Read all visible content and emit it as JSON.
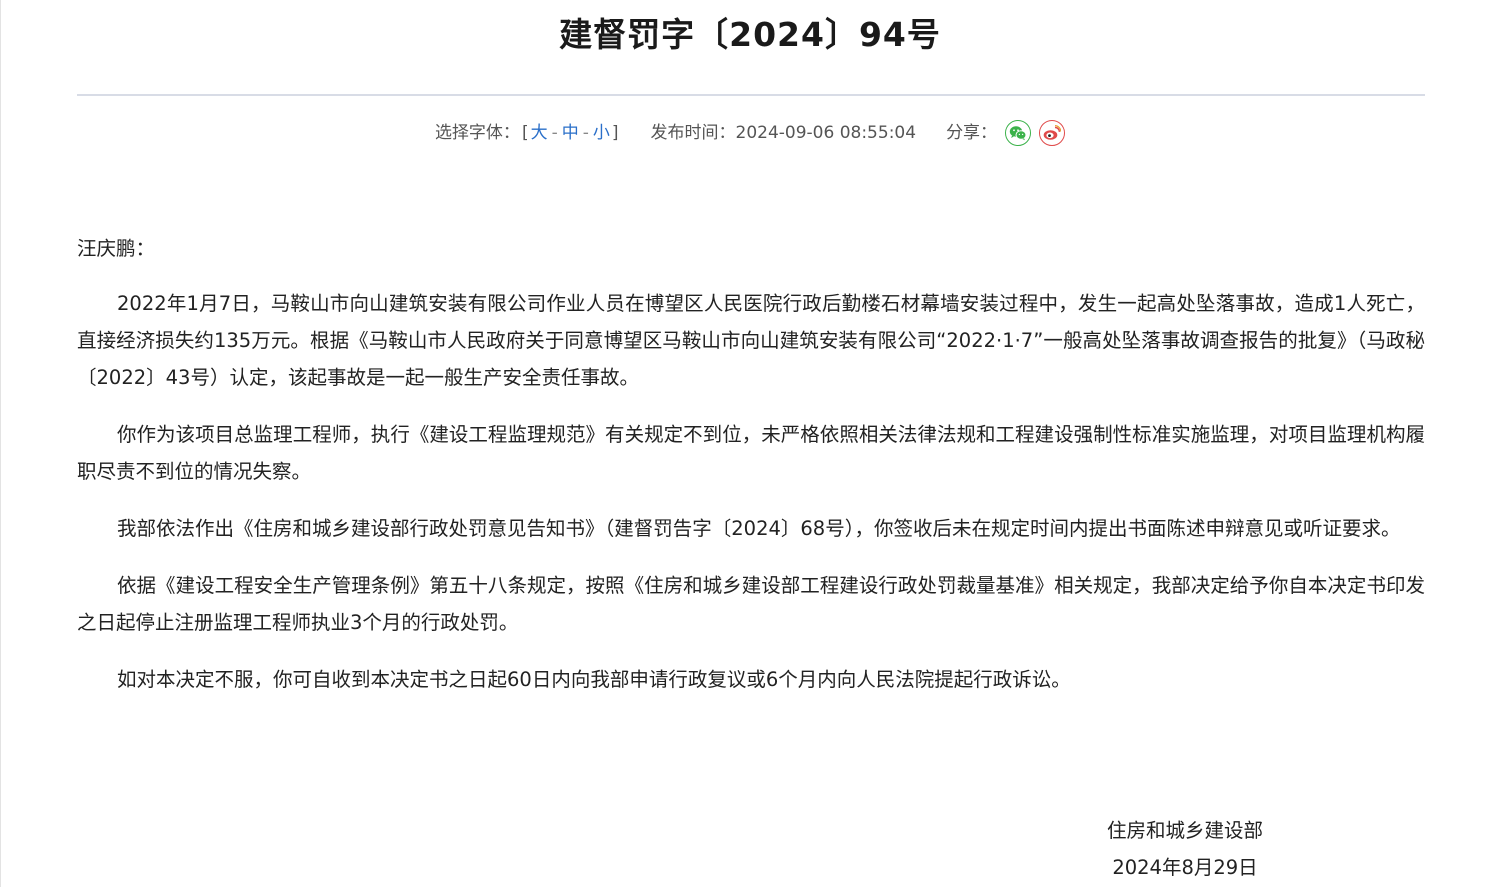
{
  "document": {
    "title": "建督罚字〔2024〕94号"
  },
  "meta": {
    "font_label": "选择字体：",
    "bracket_open": "[",
    "bracket_close": "]",
    "size_large": "大",
    "size_medium": "中",
    "size_small": "小",
    "separator": "-",
    "publish_label": "发布时间：",
    "publish_time": "2024-09-06 08:55:04",
    "share_label": "分享：",
    "share_icons": [
      "wechat-icon",
      "weibo-icon"
    ],
    "colors": {
      "link": "#2a6fc9",
      "wechat": "#3bb24a",
      "weibo": "#e04a4a",
      "divider": "#d8dce6"
    }
  },
  "body": {
    "salutation": "汪庆鹏：",
    "paragraphs": [
      "2022年1月7日，马鞍山市向山建筑安装有限公司作业人员在博望区人民医院行政后勤楼石材幕墙安装过程中，发生一起高处坠落事故，造成1人死亡，直接经济损失约135万元。根据《马鞍山市人民政府关于同意博望区马鞍山市向山建筑安装有限公司“2022·1·7”一般高处坠落事故调查报告的批复》（马政秘〔2022〕43号）认定，该起事故是一起一般生产安全责任事故。",
      "你作为该项目总监理工程师，执行《建设工程监理规范》有关规定不到位，未严格依照相关法律法规和工程建设强制性标准实施监理，对项目监理机构履职尽责不到位的情况失察。",
      "我部依法作出《住房和城乡建设部行政处罚意见告知书》（建督罚告字〔2024〕68号），你签收后未在规定时间内提出书面陈述申辩意见或听证要求。",
      "依据《建设工程安全生产管理条例》第五十八条规定，按照《住房和城乡建设部工程建设行政处罚裁量基准》相关规定，我部决定给予你自本决定书印发之日起停止注册监理工程师执业3个月的行政处罚。",
      "如对本决定不服，你可自收到本决定书之日起60日内向我部申请行政复议或6个月内向人民法院提起行政诉讼。"
    ]
  },
  "signature": {
    "organization": "住房和城乡建设部",
    "date": "2024年8月29日"
  }
}
